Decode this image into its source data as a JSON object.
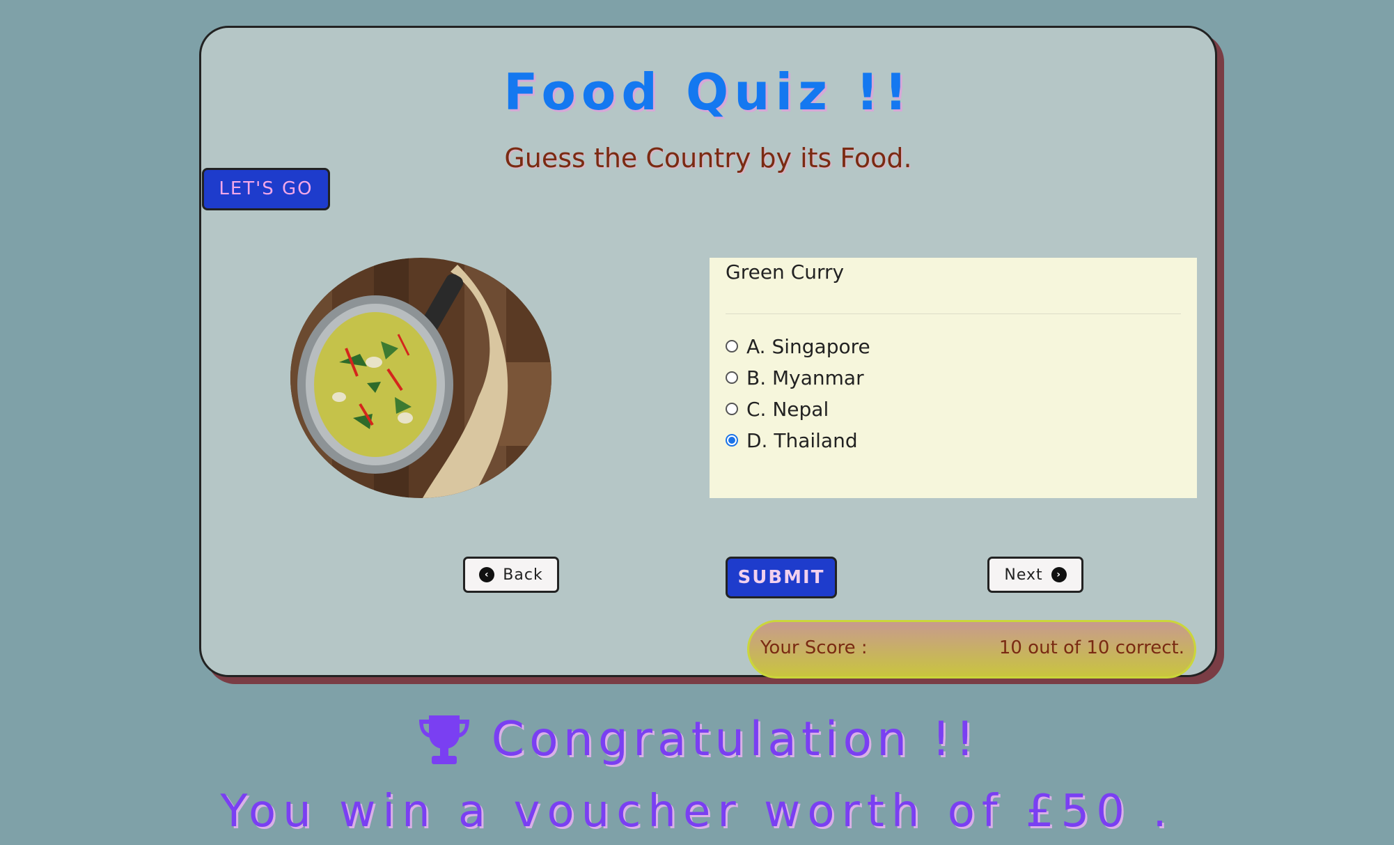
{
  "header": {
    "title": "Food Quiz !!",
    "subtitle": "Guess the Country by its Food."
  },
  "start_button": {
    "label": "LET'S GO"
  },
  "quiz": {
    "food_image_icon": "green-curry-photo",
    "question": "Green Curry",
    "options": [
      {
        "label": "A. Singapore",
        "selected": false
      },
      {
        "label": "B. Myanmar",
        "selected": false
      },
      {
        "label": "C. Nepal",
        "selected": false
      },
      {
        "label": "D. Thailand",
        "selected": true
      }
    ]
  },
  "navigation": {
    "back_label": "Back",
    "next_label": "Next",
    "submit_label": "SUBMIT"
  },
  "score": {
    "label": "Your Score :",
    "value": "10 out of 10 correct."
  },
  "result": {
    "trophy_icon": "trophy-icon",
    "congrats": "Congratulation !!",
    "voucher": "You win a voucher worth of £50 ."
  },
  "colors": {
    "background": "#7fa1a8",
    "card": "#b5c6c6",
    "title": "#1478f0",
    "button_primary": "#1e3ccc",
    "answer_panel": "#f6f6dc",
    "congrats": "#7a3ff2"
  }
}
